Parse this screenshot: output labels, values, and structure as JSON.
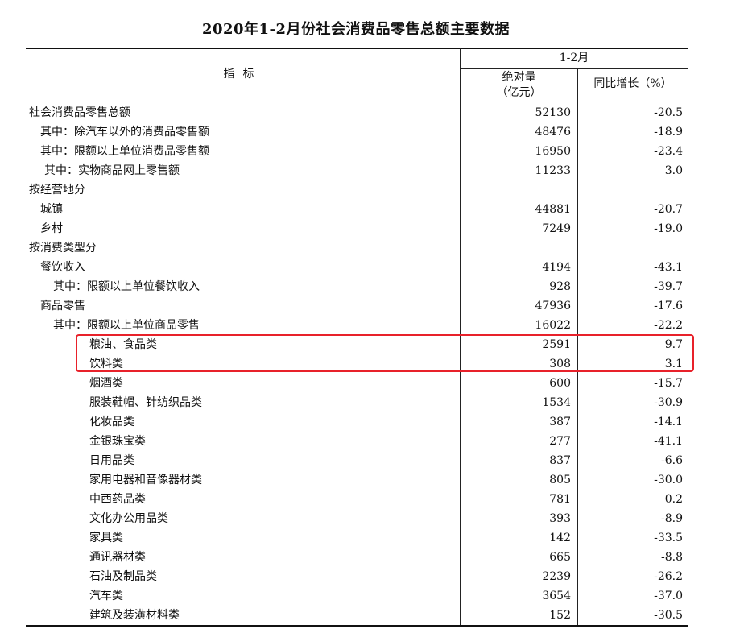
{
  "title": "2020年1-2月份社会消费品零售总额主要数据",
  "header": {
    "indicator": "指标",
    "period": "1-2月",
    "abs_line1": "绝对量",
    "abs_line2": "（亿元）",
    "yoy": "同比增长（%）"
  },
  "rows": [
    {
      "name": "社会消费品零售总额",
      "abs": "52130",
      "yoy": "-20.5"
    },
    {
      "name": "其中：除汽车以外的消费品零售额",
      "abs": "48476",
      "yoy": "-18.9"
    },
    {
      "name": "其中：限额以上单位消费品零售额",
      "abs": "16950",
      "yoy": "-23.4"
    },
    {
      "name": "其中：实物商品网上零售额",
      "abs": "11233",
      "yoy": "3.0"
    },
    {
      "name": "按经营地分",
      "abs": "",
      "yoy": ""
    },
    {
      "name": "城镇",
      "abs": "44881",
      "yoy": "-20.7"
    },
    {
      "name": "乡村",
      "abs": "7249",
      "yoy": "-19.0"
    },
    {
      "name": "按消费类型分",
      "abs": "",
      "yoy": ""
    },
    {
      "name": "餐饮收入",
      "abs": "4194",
      "yoy": "-43.1"
    },
    {
      "name": "其中：限额以上单位餐饮收入",
      "abs": "928",
      "yoy": "-39.7"
    },
    {
      "name": "商品零售",
      "abs": "47936",
      "yoy": "-17.6"
    },
    {
      "name": "其中：限额以上单位商品零售",
      "abs": "16022",
      "yoy": "-22.2"
    },
    {
      "name": "粮油、食品类",
      "abs": "2591",
      "yoy": "9.7"
    },
    {
      "name": "饮料类",
      "abs": "308",
      "yoy": "3.1"
    },
    {
      "name": "烟酒类",
      "abs": "600",
      "yoy": "-15.7"
    },
    {
      "name": "服装鞋帽、针纺织品类",
      "abs": "1534",
      "yoy": "-30.9"
    },
    {
      "name": "化妆品类",
      "abs": "387",
      "yoy": "-14.1"
    },
    {
      "name": "金银珠宝类",
      "abs": "277",
      "yoy": "-41.1"
    },
    {
      "name": "日用品类",
      "abs": "837",
      "yoy": "-6.6"
    },
    {
      "name": "家用电器和音像器材类",
      "abs": "805",
      "yoy": "-30.0"
    },
    {
      "name": "中西药品类",
      "abs": "781",
      "yoy": "0.2"
    },
    {
      "name": "文化办公用品类",
      "abs": "393",
      "yoy": "-8.9"
    },
    {
      "name": "家具类",
      "abs": "142",
      "yoy": "-33.5"
    },
    {
      "name": "通讯器材类",
      "abs": "665",
      "yoy": "-8.8"
    },
    {
      "name": "石油及制品类",
      "abs": "2239",
      "yoy": "-26.2"
    },
    {
      "name": "汽车类",
      "abs": "3654",
      "yoy": "-37.0"
    },
    {
      "name": "建筑及装潢材料类",
      "abs": "152",
      "yoy": "-30.5"
    }
  ],
  "highlight_color": "#e8212a"
}
